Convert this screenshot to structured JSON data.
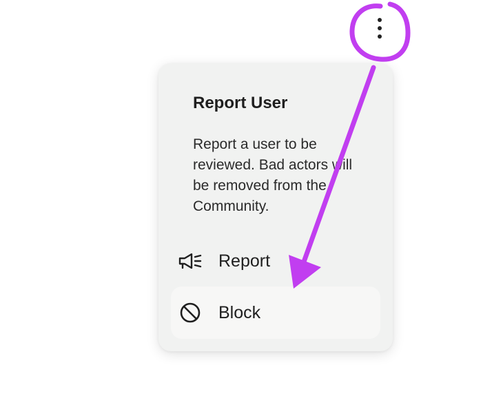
{
  "menu": {
    "title": "Report User",
    "description": "Report a user to be reviewed. Bad actors will be removed from the Community.",
    "items": [
      {
        "label": "Report",
        "icon": "megaphone-icon"
      },
      {
        "label": "Block",
        "icon": "block-icon"
      }
    ]
  },
  "trigger": {
    "icon": "more-vertical-icon"
  },
  "annotation": {
    "color": "#c13ef0"
  },
  "colors": {
    "menu_background": "#f1f2f1",
    "highlight": "#f7f7f6",
    "text": "#1f1f1f"
  }
}
